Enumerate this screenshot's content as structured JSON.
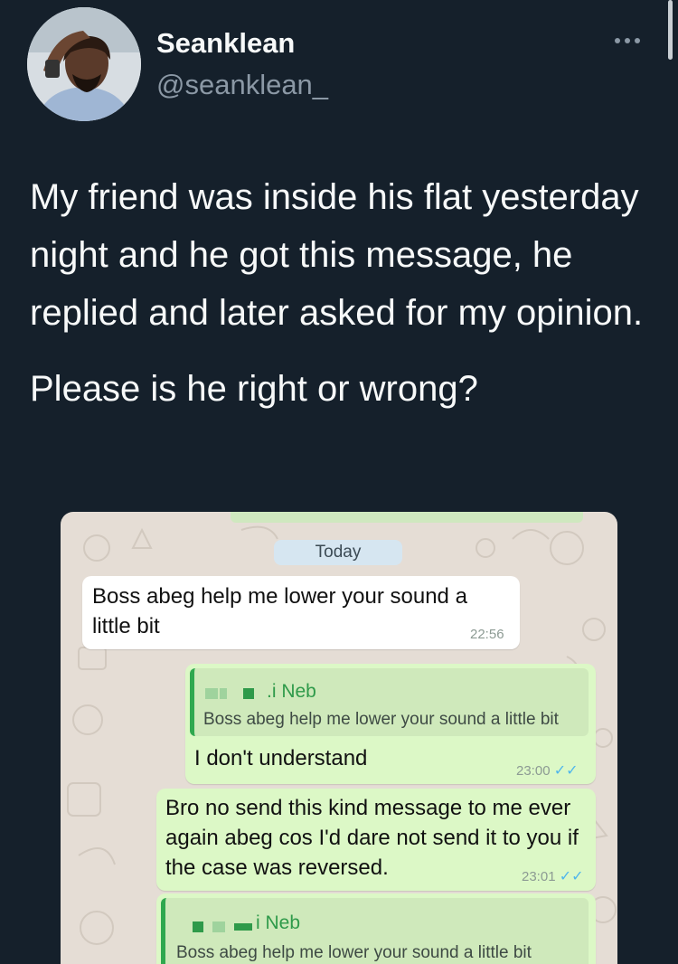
{
  "tweet": {
    "display_name": "Seanklean",
    "handle": "@seanklean_",
    "paragraph_1": "My friend was inside his flat yesterday night and he got this message, he replied and later asked for my opinion.",
    "paragraph_2": "Please is he right or wrong?"
  },
  "chat": {
    "date_label": "Today",
    "messages": [
      {
        "direction": "incoming",
        "text": "Boss abeg  help me lower your sound a little bit",
        "time": "22:56"
      },
      {
        "direction": "outgoing",
        "quote_name": ".i Neb",
        "quote_text": "Boss abeg  help me lower your sound a little bit",
        "text": "I don't understand",
        "time": "23:00"
      },
      {
        "direction": "outgoing",
        "text": "Bro no send this kind message to me ever again abeg cos I'd dare not send it to you if the case was reversed.",
        "time": "23:01"
      },
      {
        "direction": "outgoing",
        "quote_name": "i Neb",
        "quote_text": "Boss abeg  help me lower your sound a little bit"
      }
    ]
  },
  "colors": {
    "background": "#15202b",
    "chat_bg": "#e5ddd5",
    "outgoing_bubble": "#dcf8c6",
    "quote_accent": "#2f9a4a",
    "read_ticks": "#4fb6ec"
  }
}
